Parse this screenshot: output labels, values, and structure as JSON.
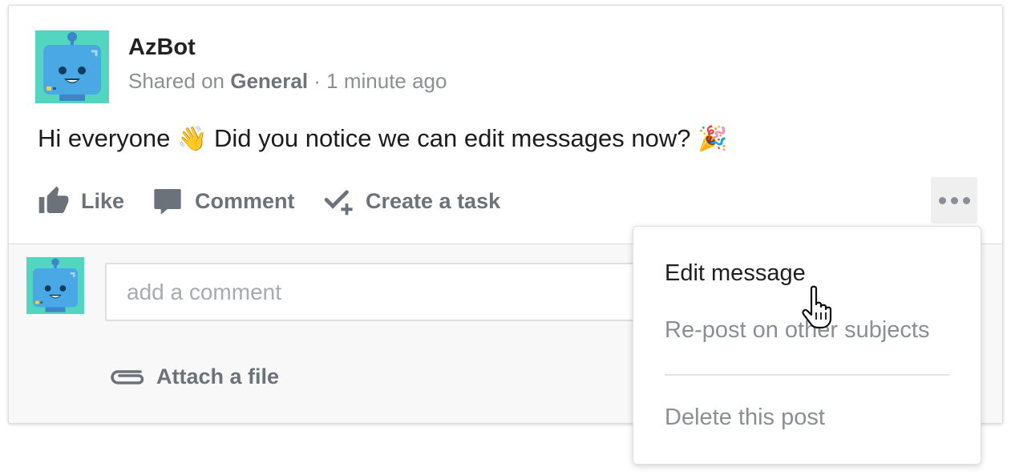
{
  "post": {
    "author": "AzBot",
    "shared_prefix": "Shared on ",
    "channel": "General",
    "time": " · 1 minute ago",
    "message_part1": "Hi everyone ",
    "emoji_wave": "👋",
    "message_part2": " Did you notice we can edit messages now? ",
    "emoji_party": "🎉"
  },
  "actions": {
    "like": "Like",
    "comment": "Comment",
    "create_task": "Create a task"
  },
  "comment_box": {
    "placeholder": "add a comment",
    "attach": "Attach a file"
  },
  "menu": {
    "edit": "Edit message",
    "repost": "Re-post on other subjects",
    "delete": "Delete this post"
  },
  "icons": {
    "like": "thumbs-up-icon",
    "comment": "speech-bubble-icon",
    "task": "check-plus-icon",
    "more": "more-horizontal-icon",
    "attach": "paperclip-icon",
    "cursor": "hand-pointer-icon"
  },
  "colors": {
    "avatar_bg": "#52d6c0",
    "robot_face": "#4aa9e4",
    "action_gray": "#6b7279"
  }
}
